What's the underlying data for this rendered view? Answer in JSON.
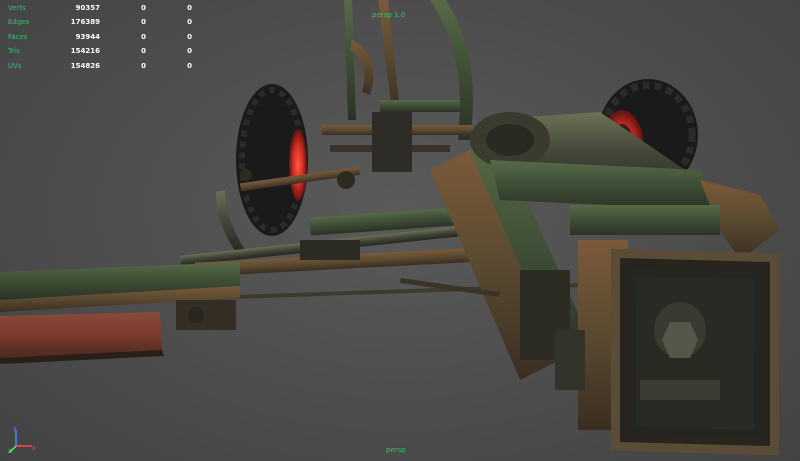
{
  "hud": {
    "rows": [
      {
        "label": "Verts",
        "values": [
          "90357",
          "0",
          "0"
        ]
      },
      {
        "label": "Edges",
        "values": [
          "176389",
          "0",
          "0"
        ]
      },
      {
        "label": "Faces",
        "values": [
          "93944",
          "0",
          "0"
        ]
      },
      {
        "label": "Tris",
        "values": [
          "154216",
          "0",
          "0"
        ]
      },
      {
        "label": "UVs",
        "values": [
          "154826",
          "0",
          "0"
        ]
      }
    ]
  },
  "camera_name": "persp 1.0",
  "view_label": "persp",
  "axis": {
    "x": "x",
    "y": "y",
    "z": "z"
  },
  "colors": {
    "background": "#4e4e4e",
    "hud_label": "#39c06a",
    "hud_value": "#ffffff",
    "metal_rust": "#6a4a2e",
    "metal_green": "#3f5a3a",
    "tire": "#1a1a1a",
    "wheel_rim_glow": "#d8322a"
  },
  "icons": [
    "axis-gizmo-icon"
  ]
}
